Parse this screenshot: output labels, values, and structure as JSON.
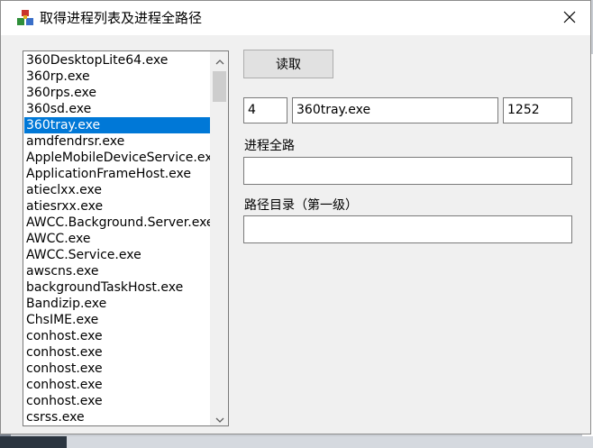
{
  "window": {
    "title": "取得进程列表及进程全路径",
    "close_glyph": "✕"
  },
  "process_list": {
    "items": [
      "360DesktopLite64.exe",
      "360rp.exe",
      "360rps.exe",
      "360sd.exe",
      "360tray.exe",
      "amdfendrsr.exe",
      "AppleMobileDeviceService.exe",
      "ApplicationFrameHost.exe",
      "atieclxx.exe",
      "atiesrxx.exe",
      "AWCC.Background.Server.exe",
      "AWCC.exe",
      "AWCC.Service.exe",
      "awscns.exe",
      "backgroundTaskHost.exe",
      "Bandizip.exe",
      "ChsIME.exe",
      "conhost.exe",
      "conhost.exe",
      "conhost.exe",
      "conhost.exe",
      "conhost.exe",
      "csrss.exe"
    ],
    "selected_index": 4
  },
  "controls": {
    "read_button": "读取",
    "index_value": "4",
    "name_value": "360tray.exe",
    "pid_value": "1252",
    "full_path_label": "进程全路",
    "full_path_value": "",
    "dir_label": "路径目录（第一级）",
    "dir_value": ""
  },
  "colors": {
    "selection": "#0078d7",
    "window_bg": "#f0f0f0"
  }
}
